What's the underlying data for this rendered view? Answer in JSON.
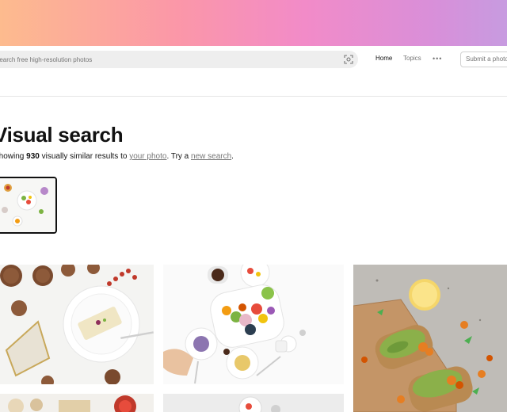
{
  "header": {
    "search_placeholder": "Search free high-resolution photos",
    "nav": {
      "home": "Home",
      "topics": "Topics",
      "more": "•••"
    },
    "submit_button": "Submit a photo"
  },
  "main": {
    "title": "Visual search",
    "subtitle": {
      "prefix": "Showing ",
      "count": "930",
      "middle": " visually similar results to ",
      "your_photo_link": "your photo",
      "middle2": ". Try a ",
      "new_search_link": "new search",
      "suffix": "."
    }
  },
  "colors": {
    "banner_gradient": [
      "#fdbb8e",
      "#fb97a8",
      "#f28bc8",
      "#c79be0"
    ],
    "text_primary": "#111111",
    "text_secondary": "#767676"
  },
  "icons": [
    "visual-search-icon",
    "more-icon"
  ]
}
